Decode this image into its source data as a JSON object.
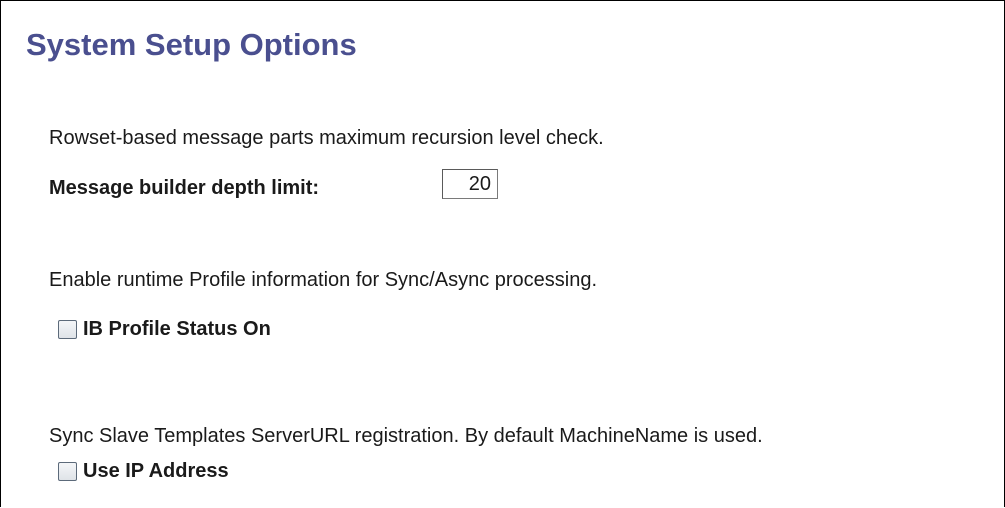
{
  "page": {
    "title": "System Setup Options"
  },
  "sections": {
    "recursion": {
      "description": "Rowset-based message parts maximum recursion level check.",
      "field_label": "Message builder depth limit:",
      "field_value": "20"
    },
    "profile": {
      "description": "Enable runtime Profile information for Sync/Async processing.",
      "checkbox_label": "IB Profile Status On",
      "checked": false
    },
    "server_url": {
      "description": "Sync Slave Templates ServerURL registration. By default MachineName is used.",
      "checkbox_label": "Use IP Address",
      "checked": false
    }
  }
}
